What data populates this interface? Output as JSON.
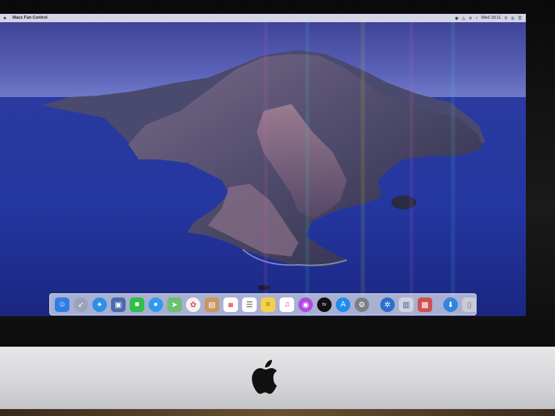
{
  "menubar": {
    "apple_icon": "apple-icon",
    "app_name": "Macs Fan Control",
    "clock": "Wed 18:11"
  },
  "dock": {
    "apps": [
      {
        "name": "finder",
        "icon": "finder-icon",
        "color": "#2e7ee6"
      },
      {
        "name": "launchpad",
        "icon": "rocket-icon",
        "color": "#9aa4b8"
      },
      {
        "name": "safari",
        "icon": "compass-icon",
        "color": "#2d8fe8"
      },
      {
        "name": "preview",
        "icon": "photo-icon",
        "color": "#4a6ab0"
      },
      {
        "name": "facetime",
        "icon": "video-camera-icon",
        "color": "#2fbf4a"
      },
      {
        "name": "messages",
        "icon": "chat-bubble-icon",
        "color": "#2f9af0"
      },
      {
        "name": "maps",
        "icon": "map-icon",
        "color": "#6cc070"
      },
      {
        "name": "photos",
        "icon": "flower-icon",
        "color": "#f2f2f2"
      },
      {
        "name": "contacts",
        "icon": "address-book-icon",
        "color": "#c89660"
      },
      {
        "name": "calendar",
        "icon": "calendar-icon",
        "color": "#ffffff"
      },
      {
        "name": "reminders",
        "icon": "checklist-icon",
        "color": "#ffffff"
      },
      {
        "name": "notes",
        "icon": "notes-icon",
        "color": "#f5d04a"
      },
      {
        "name": "music",
        "icon": "music-note-icon",
        "color": "#ffffff"
      },
      {
        "name": "podcasts",
        "icon": "podcast-icon",
        "color": "#b04ae0"
      },
      {
        "name": "apple-tv",
        "icon": "tv-icon",
        "color": "#111111"
      },
      {
        "name": "app-store",
        "icon": "app-store-icon",
        "color": "#1f8cf0"
      },
      {
        "name": "system-preferences",
        "icon": "gear-icon",
        "color": "#7a7f88"
      }
    ],
    "others": [
      {
        "name": "fan-control",
        "icon": "fan-icon",
        "color": "#2b6fd0"
      },
      {
        "name": "document-1",
        "icon": "document-icon",
        "color": "#d0d4e0"
      },
      {
        "name": "document-2",
        "icon": "document-stack-icon",
        "color": "#d05050"
      },
      {
        "name": "downloads",
        "icon": "downloads-icon",
        "color": "#2f86e0"
      },
      {
        "name": "trash",
        "icon": "trash-icon",
        "color": "#c8ccd6"
      }
    ]
  },
  "hardware": {
    "chin_logo": "apple-logo-icon"
  }
}
